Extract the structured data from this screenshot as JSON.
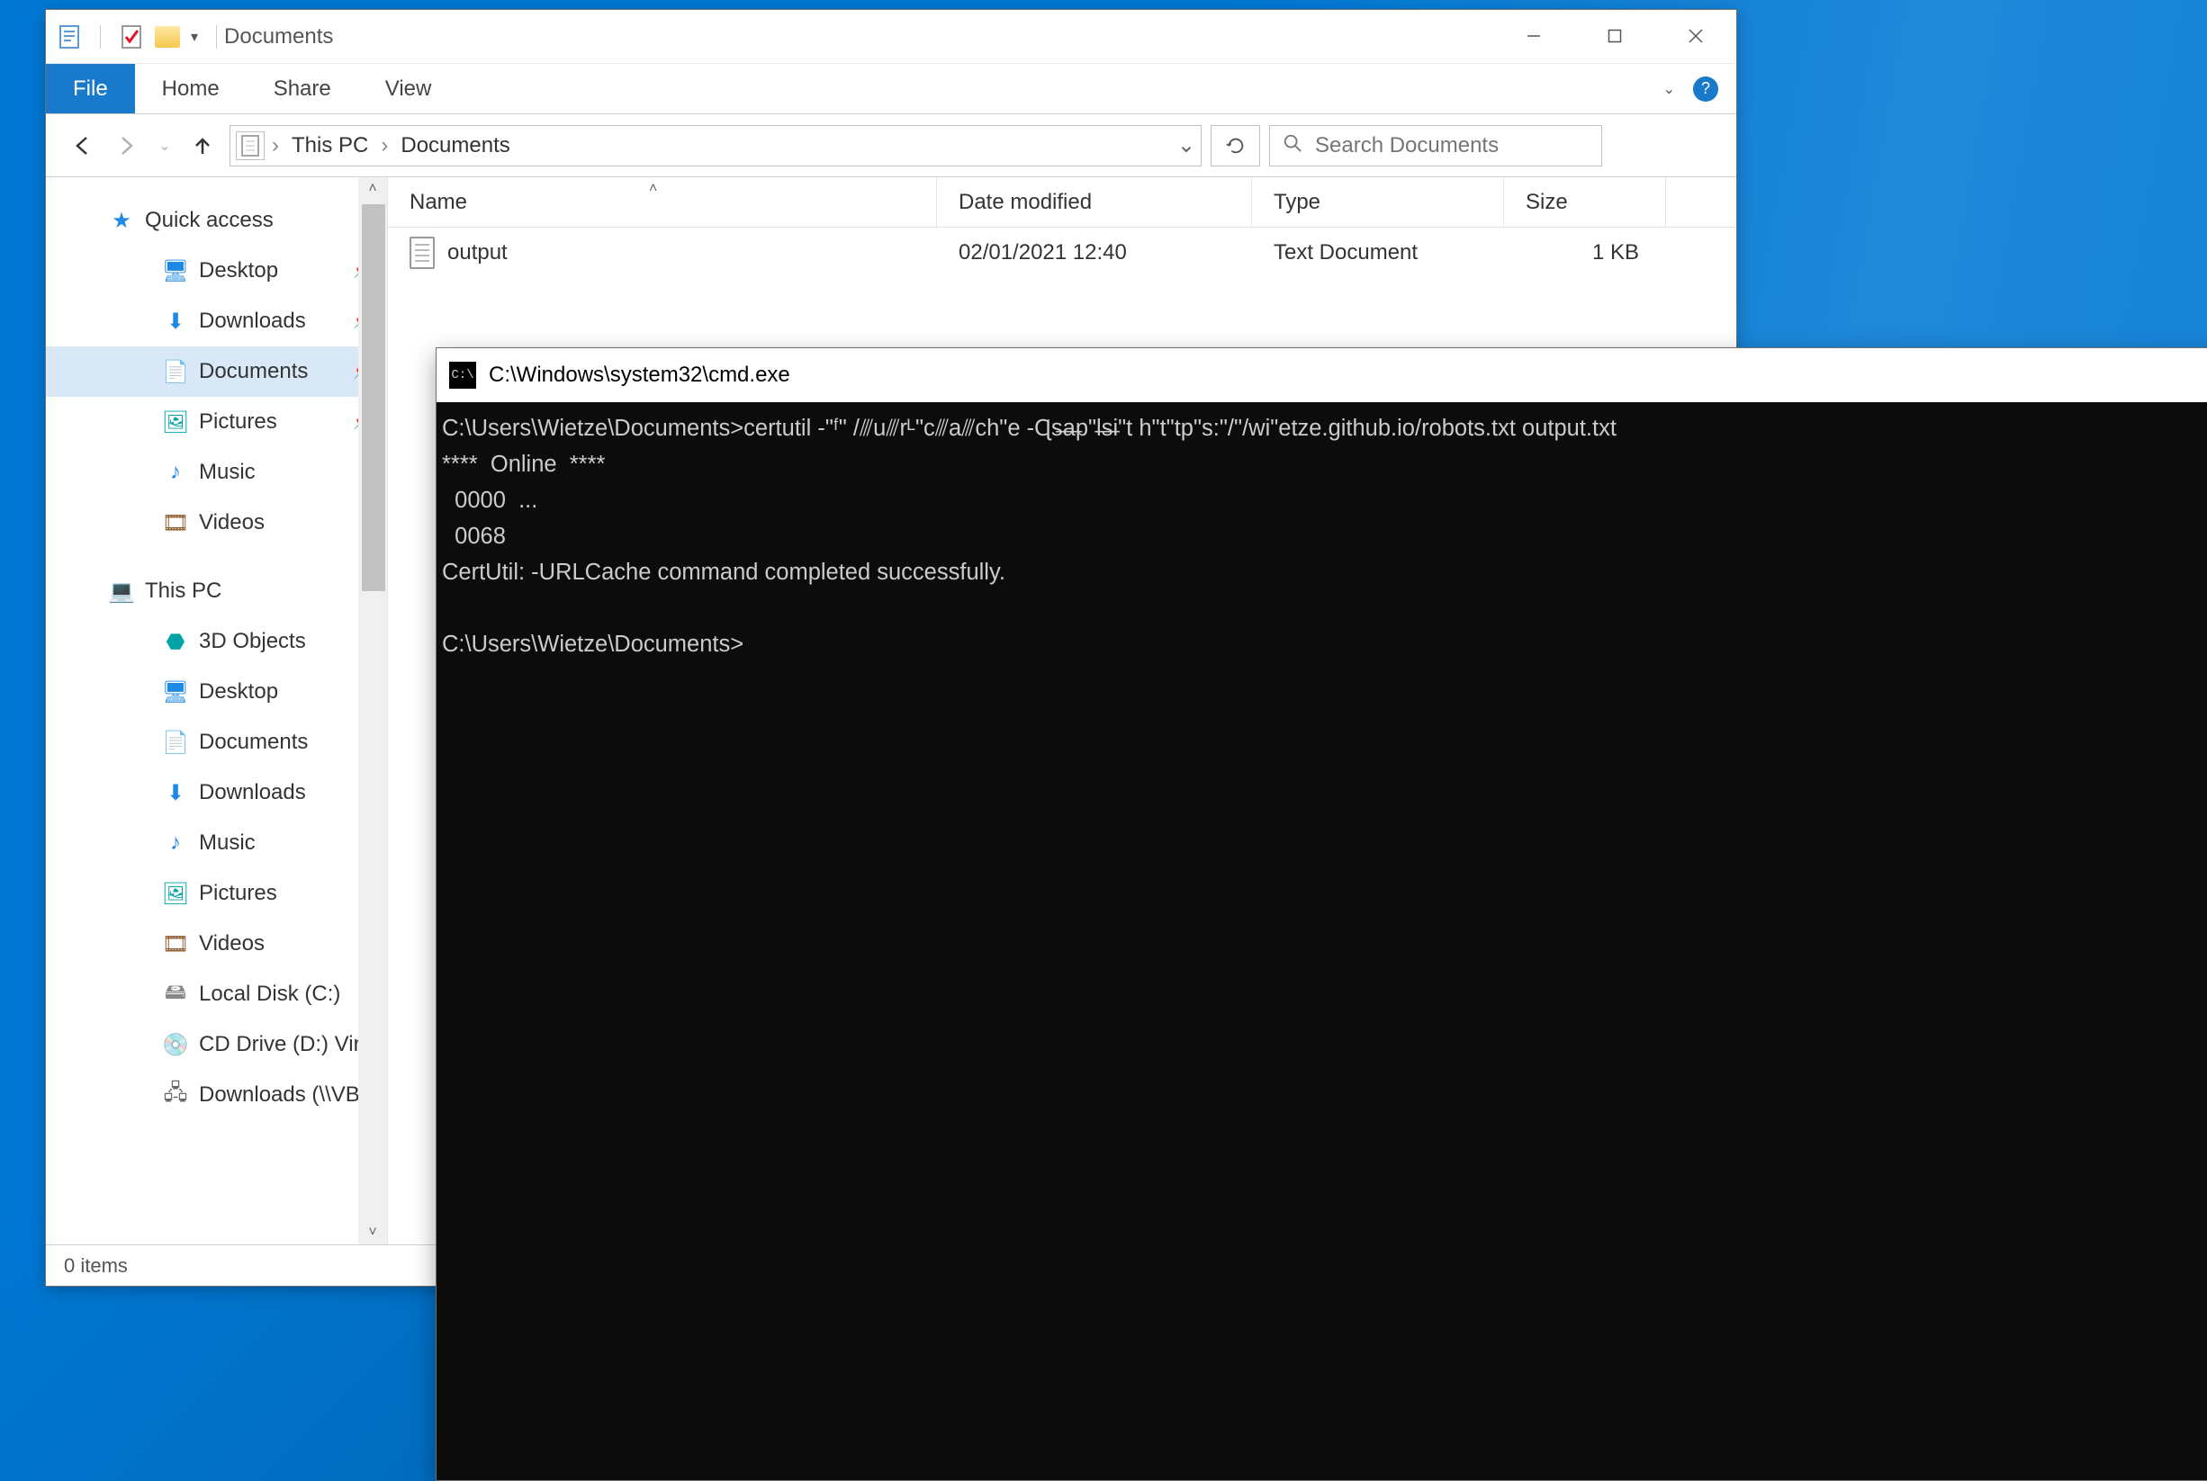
{
  "explorer": {
    "title": "Documents",
    "ribbon": {
      "file": "File",
      "home": "Home",
      "share": "Share",
      "view": "View"
    },
    "breadcrumb": {
      "root": "This PC",
      "leaf": "Documents"
    },
    "search_placeholder": "Search Documents",
    "columns": {
      "name": "Name",
      "date": "Date modified",
      "type": "Type",
      "size": "Size"
    },
    "row": {
      "name": "output",
      "date": "02/01/2021 12:40",
      "type": "Text Document",
      "size": "1 KB"
    },
    "sidebar": {
      "quick": "Quick access",
      "desktop": "Desktop",
      "downloads": "Downloads",
      "documents": "Documents",
      "pictures": "Pictures",
      "music": "Music",
      "videos": "Videos",
      "thispc": "This PC",
      "objects3d": "3D Objects",
      "desktop2": "Desktop",
      "documents2": "Documents",
      "downloads2": "Downloads",
      "music2": "Music",
      "pictures2": "Pictures",
      "videos2": "Videos",
      "localdisk": "Local Disk (C:)",
      "cddrive": "CD Drive (D:) Vir",
      "netdownloads": "Downloads (\\\\VB"
    },
    "status": "0 items"
  },
  "cmd": {
    "title": "C:\\Windows\\system32\\cmd.exe",
    "logo": "C:\\",
    "line1": "C:\\Users\\Wietze\\Documents>certutil -\"ᶠ\" /⫻u⫻rᴸ\"c⫻a⫻ch\"e -Ɋs̶a̶p\"l̶s̶i\"t h\"t\"tp\"s:\"/\"/wi\"etze.github.io/robots.txt output.txt",
    "line2": "****  Online  ****",
    "line3": "  0000  ...",
    "line4": "  0068",
    "line5": "CertUtil: -URLCache command completed successfully.",
    "line6": "",
    "line7": "C:\\Users\\Wietze\\Documents>"
  }
}
